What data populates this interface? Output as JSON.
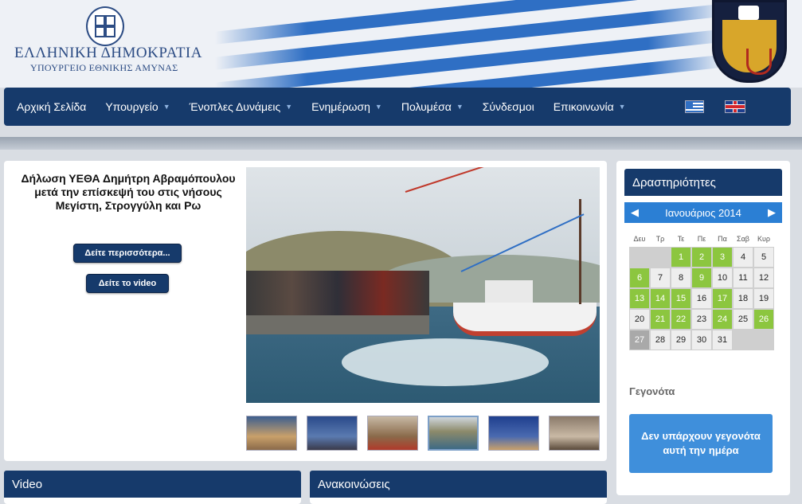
{
  "header": {
    "brand_line1": "ΕΛΛΗΝΙΚΗ ΔΗΜΟΚΡΑΤΙΑ",
    "brand_line2": "ΥΠΟΥΡΓΕΙΟ ΕΘΝΙΚΗΣ ΑΜΥΝΑΣ"
  },
  "nav": {
    "items": [
      {
        "label": "Αρχική Σελίδα",
        "has_dropdown": false
      },
      {
        "label": "Υπουργείο",
        "has_dropdown": true
      },
      {
        "label": "Ένοπλες Δυνάμεις",
        "has_dropdown": true
      },
      {
        "label": "Ενημέρωση",
        "has_dropdown": true
      },
      {
        "label": "Πολυμέσα",
        "has_dropdown": true
      },
      {
        "label": "Σύνδεσμοι",
        "has_dropdown": false
      },
      {
        "label": "Επικοινωνία",
        "has_dropdown": true
      }
    ],
    "languages": [
      "greek-flag-icon",
      "uk-flag-icon"
    ]
  },
  "featured": {
    "title": "Δήλωση ΥΕΘΑ Δημήτρη Αβραμόπουλου μετά την επίσκεψή του στις νήσους Μεγίστη, Στρογγύλη και Ρω",
    "more_button": "Δείτε περισσότερα...",
    "video_button": "Δείτε το video"
  },
  "sidebar": {
    "title": "Δραστηριότητες",
    "calendar": {
      "month": "Ιανουάριος 2014",
      "weekdays": [
        "Δευ",
        "Τρ",
        "Τε",
        "Πε",
        "Πα",
        "Σαβ",
        "Κυρ"
      ],
      "cells": [
        {
          "d": "",
          "t": "empty"
        },
        {
          "d": "",
          "t": "empty"
        },
        {
          "d": "1",
          "t": "ev"
        },
        {
          "d": "2",
          "t": "ev"
        },
        {
          "d": "3",
          "t": "ev"
        },
        {
          "d": "4",
          "t": ""
        },
        {
          "d": "5",
          "t": ""
        },
        {
          "d": "6",
          "t": "ev"
        },
        {
          "d": "7",
          "t": ""
        },
        {
          "d": "8",
          "t": ""
        },
        {
          "d": "9",
          "t": "ev"
        },
        {
          "d": "10",
          "t": ""
        },
        {
          "d": "11",
          "t": ""
        },
        {
          "d": "12",
          "t": ""
        },
        {
          "d": "13",
          "t": "ev"
        },
        {
          "d": "14",
          "t": "ev"
        },
        {
          "d": "15",
          "t": "ev"
        },
        {
          "d": "16",
          "t": ""
        },
        {
          "d": "17",
          "t": "ev"
        },
        {
          "d": "18",
          "t": ""
        },
        {
          "d": "19",
          "t": ""
        },
        {
          "d": "20",
          "t": ""
        },
        {
          "d": "21",
          "t": "ev"
        },
        {
          "d": "22",
          "t": "ev"
        },
        {
          "d": "23",
          "t": ""
        },
        {
          "d": "24",
          "t": "ev"
        },
        {
          "d": "25",
          "t": ""
        },
        {
          "d": "26",
          "t": "ev"
        },
        {
          "d": "27",
          "t": "out"
        },
        {
          "d": "28",
          "t": ""
        },
        {
          "d": "29",
          "t": ""
        },
        {
          "d": "30",
          "t": ""
        },
        {
          "d": "31",
          "t": ""
        },
        {
          "d": "",
          "t": "empty"
        },
        {
          "d": "",
          "t": "empty"
        }
      ]
    },
    "events_label": "Γεγονότα",
    "no_events": "Δεν υπάρχουν γεγονότα αυτή την ημέρα"
  },
  "panels": {
    "video": "Video",
    "announcements": "Ανακοινώσεις"
  },
  "colors": {
    "navy": "#163a6b",
    "event_green": "#8cc63f",
    "calendar_blue": "#2b7fd4"
  }
}
